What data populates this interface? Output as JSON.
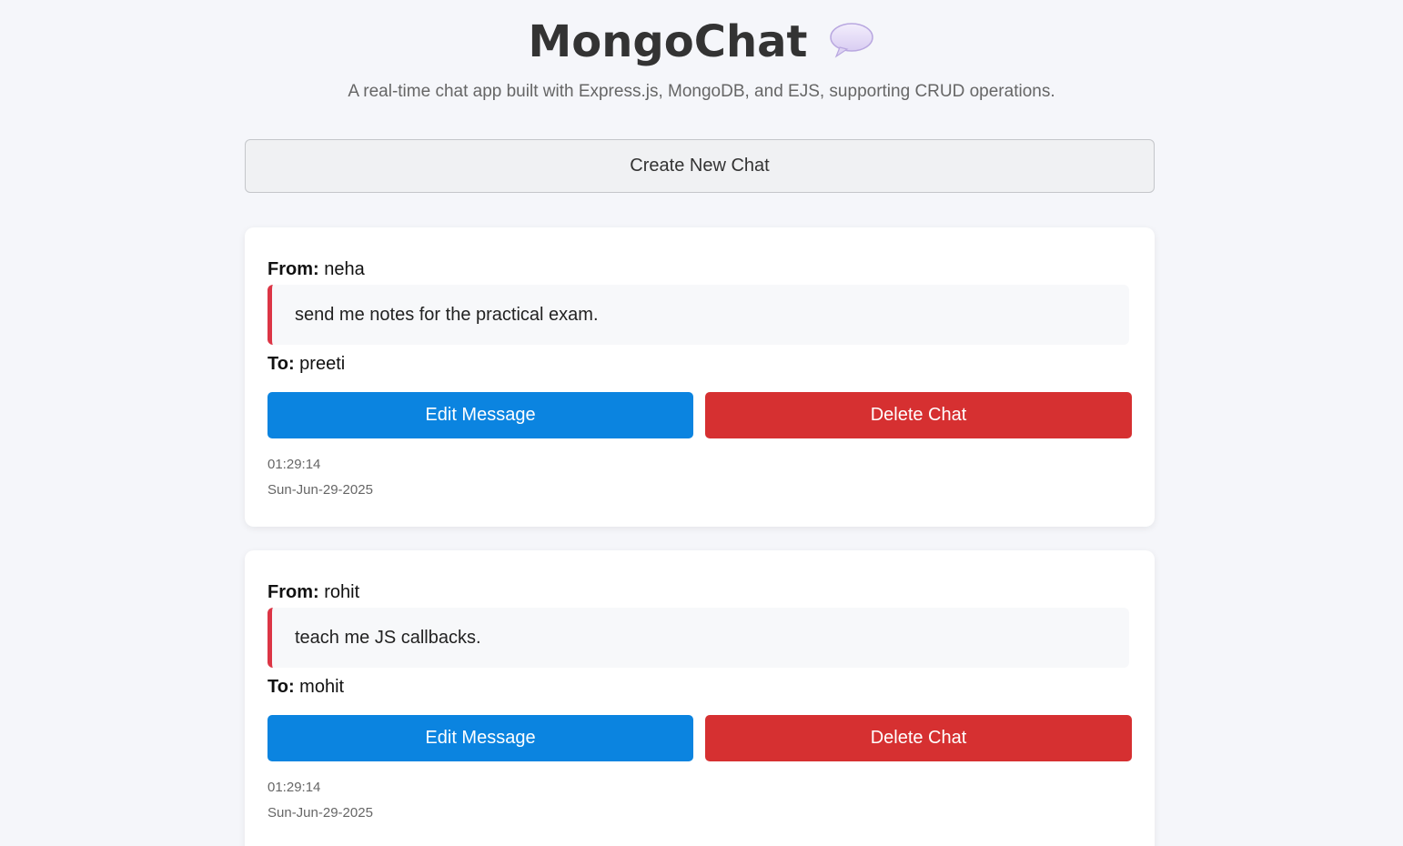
{
  "header": {
    "title": "MongoChat",
    "subtitle": "A real-time chat app built with Express.js, MongoDB, and EJS, supporting CRUD operations.",
    "icon": "speech-bubble-icon"
  },
  "actions": {
    "create_label": "Create New Chat"
  },
  "chats": [
    {
      "from_label": "From:",
      "from": "neha",
      "message": "send me notes for the practical exam.",
      "to_label": "To:",
      "to": "preeti",
      "edit_label": "Edit Message",
      "delete_label": "Delete Chat",
      "time": "01:29:14",
      "date": "Sun-Jun-29-2025"
    },
    {
      "from_label": "From:",
      "from": "rohit",
      "message": "teach me JS callbacks.",
      "to_label": "To:",
      "to": "mohit",
      "edit_label": "Edit Message",
      "delete_label": "Delete Chat",
      "time": "01:29:14",
      "date": "Sun-Jun-29-2025"
    }
  ],
  "colors": {
    "edit": "#0b84e0",
    "delete": "#d63031",
    "accent_border": "#dc3545",
    "background": "#f5f6fa"
  }
}
